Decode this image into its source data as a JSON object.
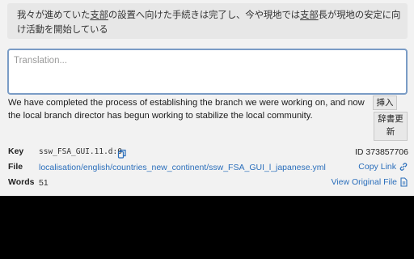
{
  "source": {
    "segments": [
      {
        "text": "我々が進めていた",
        "underline": false
      },
      {
        "text": "支部",
        "underline": true
      },
      {
        "text": "の設置へ向けた手続きは完了し、今や現地では",
        "underline": false
      },
      {
        "text": "支部",
        "underline": true
      },
      {
        "text": "長が現地の安定に向け活動を開始している",
        "underline": false
      }
    ]
  },
  "translation": {
    "placeholder": "Translation...",
    "value": ""
  },
  "machine_translation": "We have completed the process of establishing the branch we were working on, and now the local branch director has begun working to stabilize the local community.",
  "buttons": {
    "insert_label": "挿入",
    "dictionary_update_label": "辞書更新"
  },
  "meta": {
    "key_label": "Key",
    "key_value": "ssw_FSA_GUI.11.d:0",
    "file_label": "File",
    "file_value": "localisation/english/countries_new_continent/ssw_FSA_GUI_l_japanese.yml",
    "words_label": "Words",
    "words_value": "51",
    "id_text": "ID 373857706",
    "copy_link_label": "Copy Link",
    "view_original_label": "View Original File"
  },
  "icons": {
    "copy": "copy-icon",
    "link": "link-icon",
    "file": "file-icon"
  },
  "colors": {
    "panel_bg": "#f2f2f2",
    "source_bg": "#e7e7e7",
    "focus_border": "#7a9cc6",
    "link": "#2a6ebb",
    "backdrop": "#000000"
  }
}
